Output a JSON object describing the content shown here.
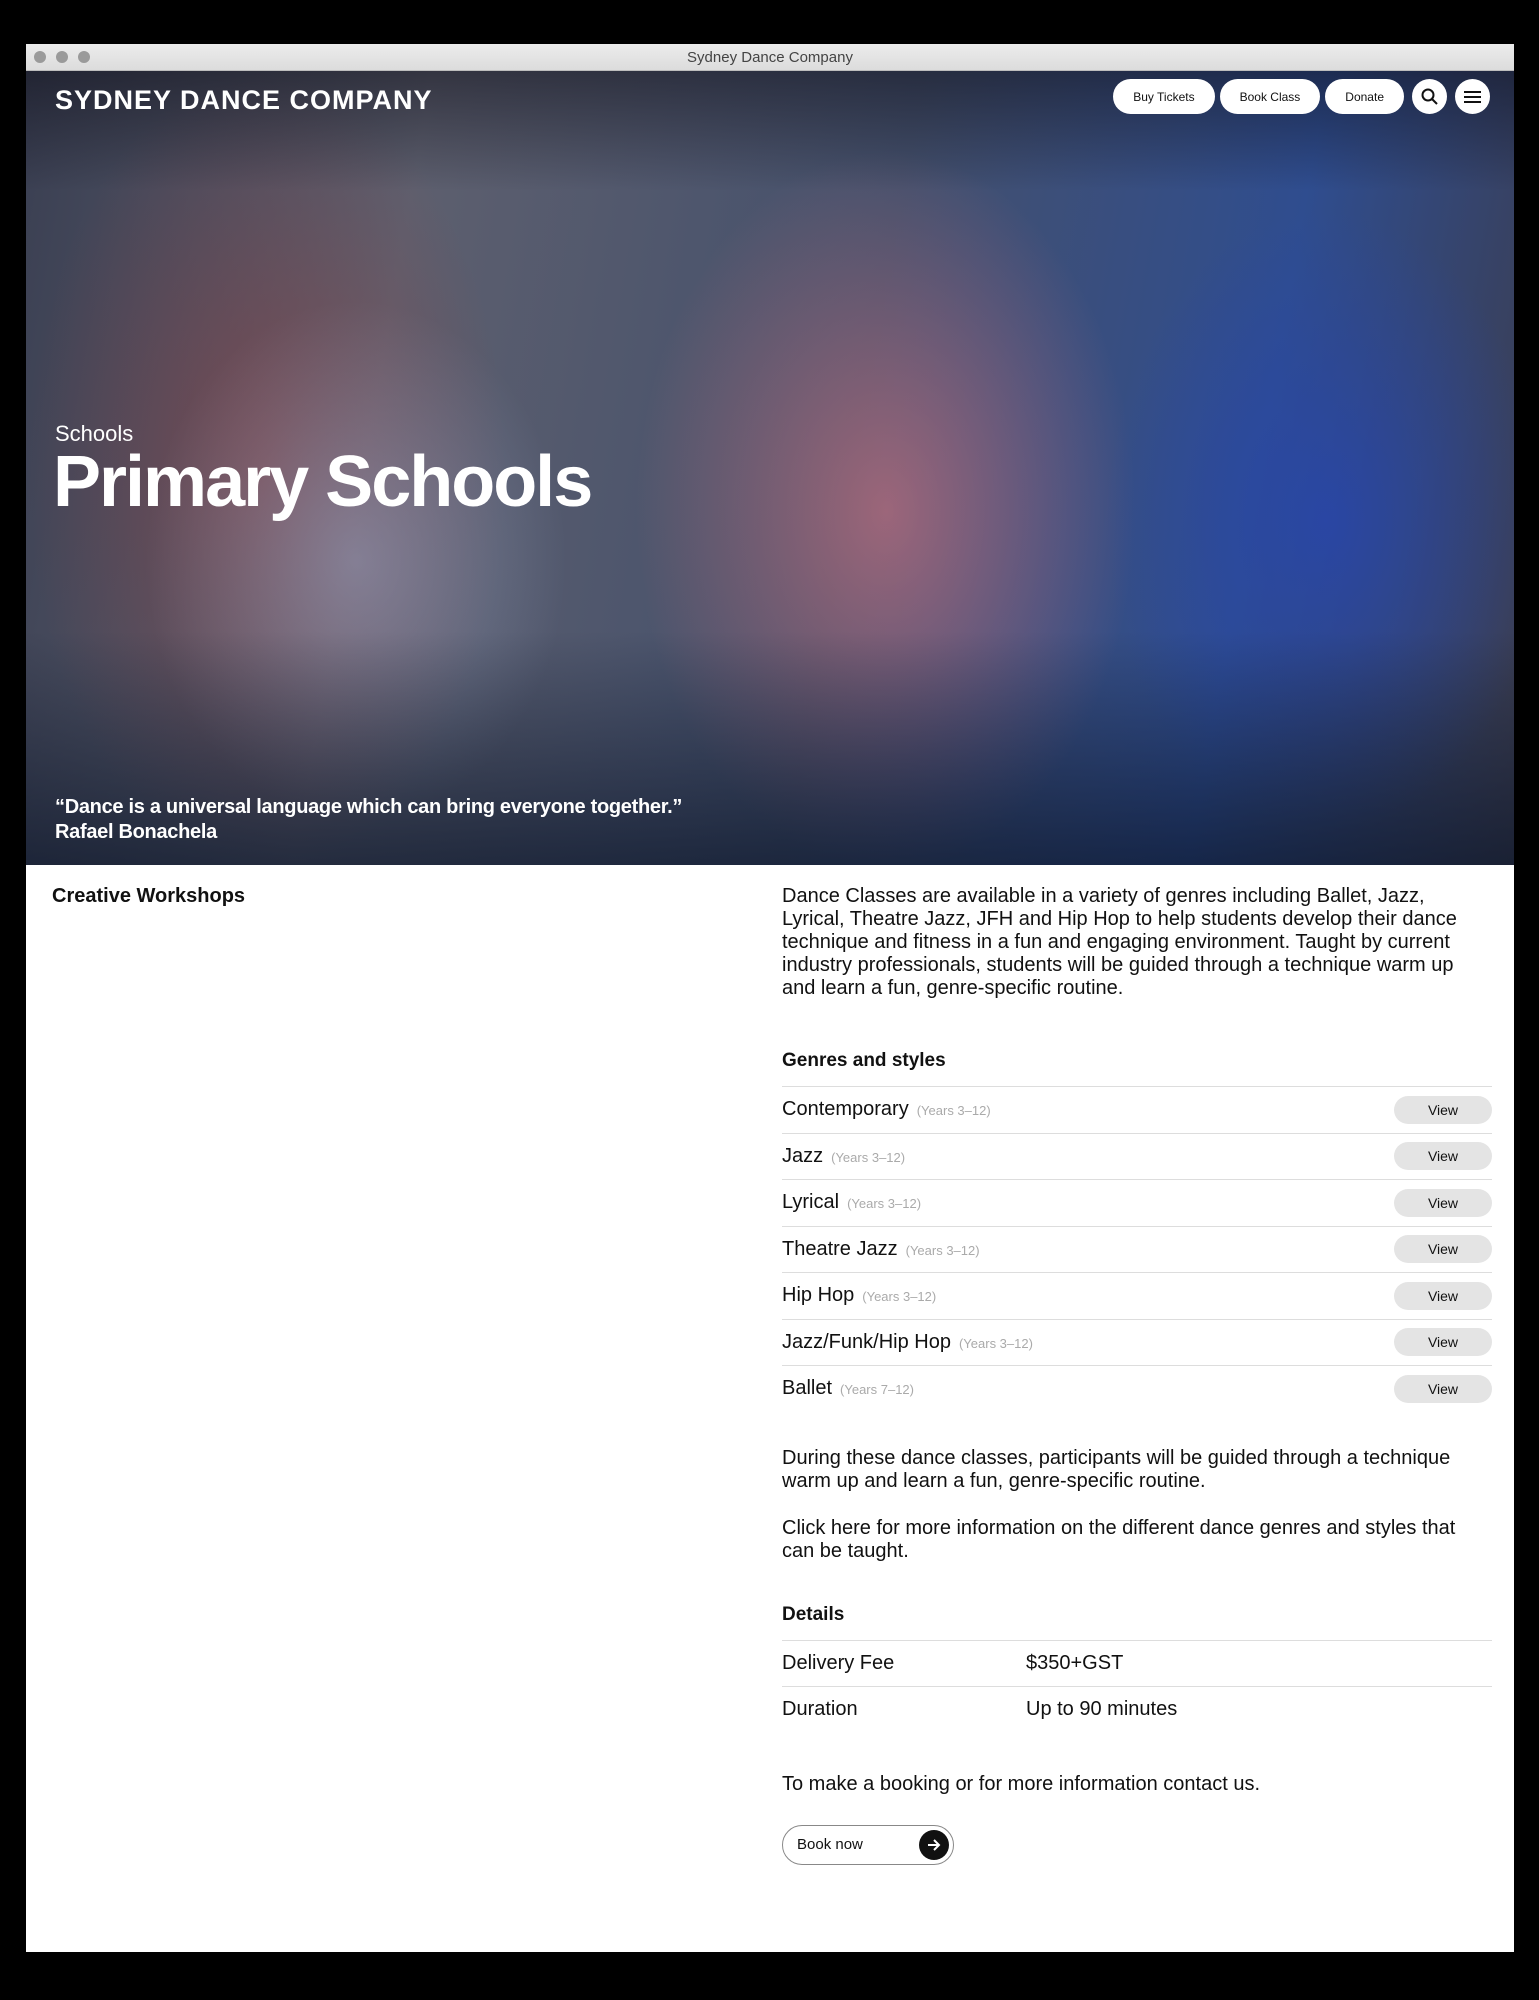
{
  "window": {
    "title": "Sydney Dance Company"
  },
  "header": {
    "logo": "SYDNEY DANCE COMPANY",
    "nav": {
      "buy_tickets": "Buy Tickets",
      "book_class": "Book Class",
      "donate": "Donate"
    },
    "icons": {
      "search": "search-icon",
      "menu": "menu-icon"
    }
  },
  "hero": {
    "subtitle": "Schools",
    "title": "Primary Schools",
    "quote": "“Dance is a universal language which can bring everyone together.”",
    "quote_author": "Rafael Bonachela"
  },
  "sidebar": {
    "heading": "Creative Workshops"
  },
  "main": {
    "intro": "Dance Classes are available in a variety of genres including Ballet, Jazz, Lyrical, Theatre Jazz, JFH and Hip Hop to help students develop their dance technique and fitness in a fun and engaging environment. Taught by current industry professionals, students will be guided through a technique warm up and learn a fun, genre-specific routine.",
    "genres_title": "Genres and styles",
    "genres": [
      {
        "name": "Contemporary",
        "age": "(Years 3–12)",
        "button": "View"
      },
      {
        "name": "Jazz",
        "age": "(Years 3–12)",
        "button": "View"
      },
      {
        "name": "Lyrical",
        "age": "(Years 3–12)",
        "button": "View"
      },
      {
        "name": "Theatre Jazz",
        "age": "(Years 3–12)",
        "button": "View"
      },
      {
        "name": "Hip Hop",
        "age": "(Years 3–12)",
        "button": "View"
      },
      {
        "name": "Jazz/Funk/Hip Hop",
        "age": "(Years 3–12)",
        "button": "View"
      },
      {
        "name": "Ballet",
        "age": "(Years 7–12)",
        "button": "View"
      }
    ],
    "para1": "During these dance classes, participants will be guided through a technique warm up and learn a fun, genre-specific routine.",
    "para2": "Click here for more information on the different dance genres and styles that can be taught.",
    "details_title": "Details",
    "details": [
      {
        "label": "Delivery Fee",
        "value": "$350+GST"
      },
      {
        "label": "Duration",
        "value": "Up to 90 minutes"
      }
    ],
    "contact": "To make a booking or for more information contact us.",
    "book_button": "Book now"
  }
}
